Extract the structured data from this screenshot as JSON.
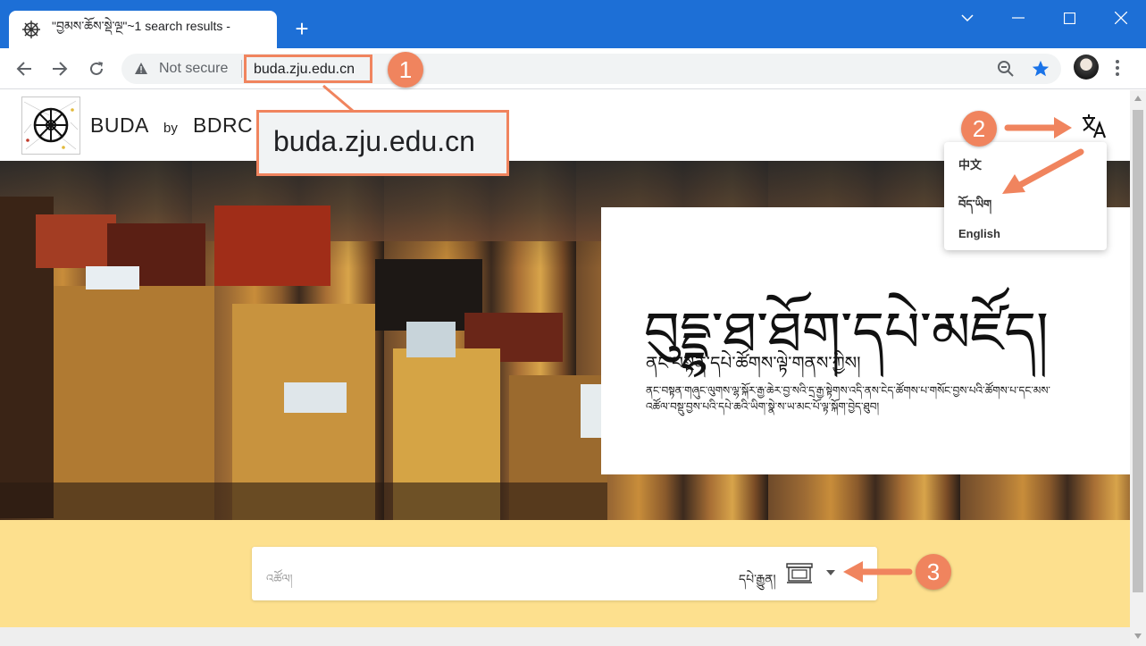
{
  "browser": {
    "tab_title": "\"བྱམས་ཆོས་སྡེ་ལྔ\"~1 search results -",
    "new_tab_symbol": "+",
    "address": {
      "security_label": "Not secure",
      "url": "buda.zju.edu.cn"
    }
  },
  "site": {
    "brand_name": "BUDA",
    "brand_by": "by",
    "brand_org": "BDRC"
  },
  "hero": {
    "title": "བུདྡྷ་ཐ་ཐོག་དཔེ་མཛོད།",
    "subtitle": "ནང་བསྟན་དཔེ་ཚོགས་ལྟེ་གནས་ཀྱིས།",
    "description": "ནང་བསྟན་གཞུང་ལུགས་ལྷ་སྐོར་རྒྱ་ཆེར་བྱ་སའི་དྲ་རྒྱ་སྟེགས་འདི་ནས་ངེད་ཚོགས་པ་གསོང་བྱས་པའི་ཚོགས་པ་དང་མས་འཚོལ་བསྡུ་བྱས་པའི་དཔེ་ཆའི་ཡིག་སྣེ་ས་ཡ་མང་པོ་ལྟ་སྐོག་བྱེད་ཐུབ།"
  },
  "language_menu": {
    "items": [
      "中文",
      "བོད་ཡིག",
      "English"
    ]
  },
  "search": {
    "placeholder": "འཚོལ།",
    "scope_label": "དཔེ་རྒྱུན།"
  },
  "annotations": {
    "badge1": "1",
    "badge2": "2",
    "badge3": "3",
    "zoom_text": "buda.zju.edu.cn"
  },
  "colors": {
    "chrome_blue": "#1d6fd6",
    "annotation_orange": "#f0845e",
    "search_band": "#fde08e"
  },
  "icons": [
    "dharma-wheel-icon",
    "back-arrow-icon",
    "forward-arrow-icon",
    "reload-icon",
    "warning-icon",
    "zoom-icon",
    "star-icon",
    "kebab-menu-icon",
    "translate-icon",
    "book-icon",
    "caret-down-icon"
  ]
}
